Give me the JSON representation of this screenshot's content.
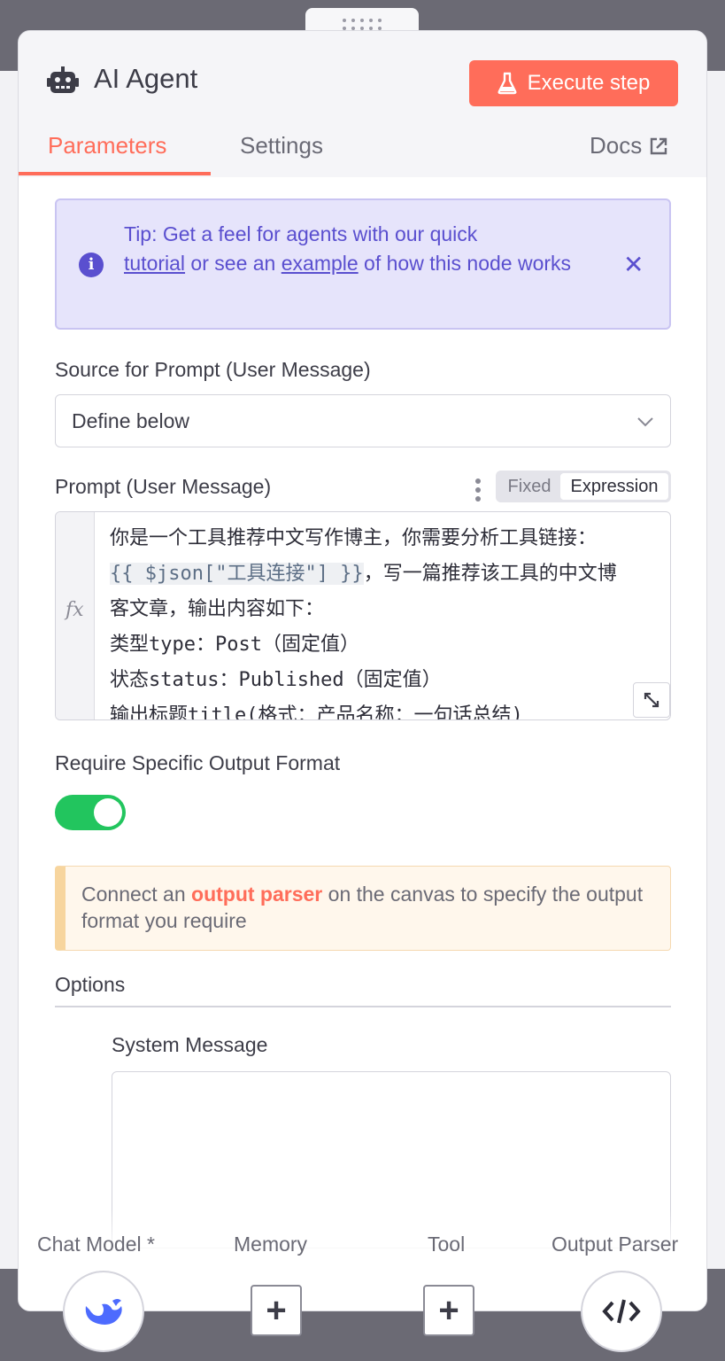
{
  "header": {
    "title": "AI Agent",
    "execute_label": "Execute step"
  },
  "tabs": {
    "parameters": "Parameters",
    "settings": "Settings",
    "docs": "Docs"
  },
  "tip": {
    "prefix": "Tip: Get a feel for agents with our quick",
    "link_tutorial": "tutorial",
    "middle": " or see an ",
    "link_example": "example",
    "suffix": " of how this node works"
  },
  "source_prompt": {
    "label": "Source for Prompt (User Message)",
    "value": "Define below"
  },
  "prompt": {
    "label": "Prompt (User Message)",
    "mode_fixed": "Fixed",
    "mode_expression": "Expression",
    "line1": "你是一个工具推荐中文写作博主，你需要分析工具链接：",
    "line2_expr": "{{ $json[\"工具连接\"] }}",
    "line2_rest": "，写一篇推荐该工具的中文博",
    "line3": "客文章，输出内容如下：",
    "line4": "类型type：Post（固定值）",
    "line5": "状态status：Published（固定值）",
    "line6": "输出标题title(格式：产品名称：一句话总结)"
  },
  "output_format": {
    "label": "Require Specific Output Format",
    "enabled": true,
    "accent": "#22c55e"
  },
  "notice": {
    "prefix": "Connect an ",
    "highlight": "output parser",
    "suffix": " on the canvas to specify the output format you require"
  },
  "options": {
    "label": "Options",
    "system_message_label": "System Message",
    "system_message_value": ""
  },
  "connectors": {
    "chat_model": "Chat Model *",
    "memory": "Memory",
    "tool": "Tool",
    "output_parser": "Output Parser"
  },
  "colors": {
    "brand": "#ff6d5a",
    "tip": "#5a4fcf",
    "deepseek": "#4d6bfe"
  }
}
